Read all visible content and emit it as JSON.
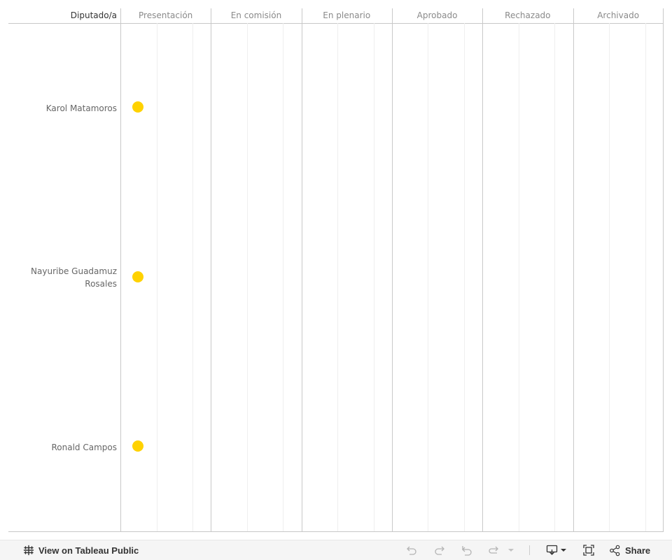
{
  "table": {
    "row_header": "Diputado/a",
    "columns": [
      "Presentación",
      "En comisión",
      "En plenario",
      "Aprobado",
      "Rechazado",
      "Archivado"
    ],
    "rows": [
      {
        "label": "Karol Matamoros",
        "stage": "Presentación"
      },
      {
        "label": "Nayuribe Guadamuz Rosales",
        "stage": "Presentación"
      },
      {
        "label": "Ronald Campos",
        "stage": "Presentación"
      }
    ],
    "marker_color": "#ffd200"
  },
  "toolbar": {
    "view_label": "View on Tableau Public",
    "share_label": "Share",
    "icons": [
      "tableau-logo-icon",
      "undo-icon",
      "redo-icon",
      "revert-icon",
      "refresh-icon",
      "dropdown-caret-icon",
      "download-icon",
      "fullscreen-icon",
      "share-icon"
    ]
  }
}
